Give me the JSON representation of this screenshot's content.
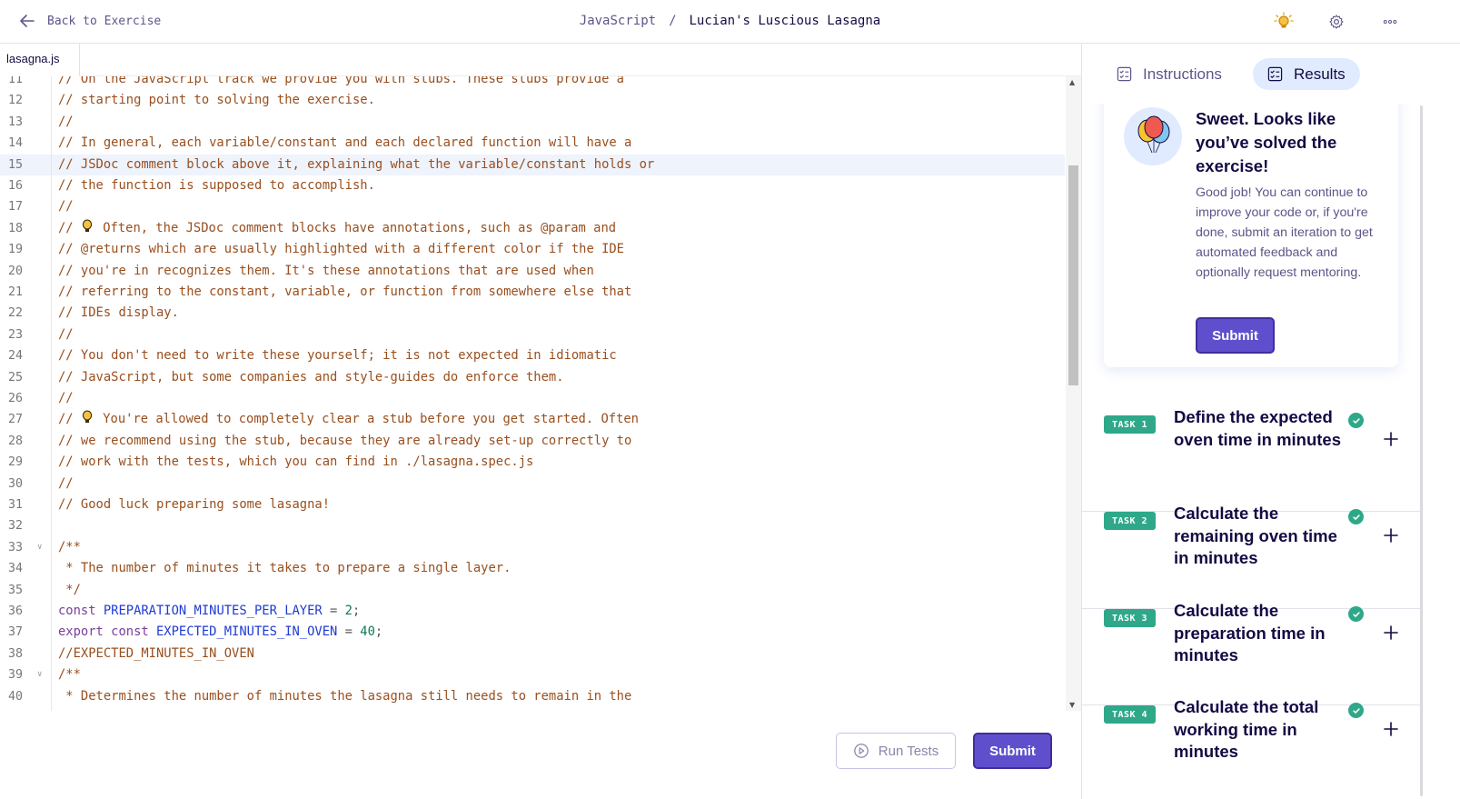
{
  "header": {
    "back_label": "Back to Exercise",
    "track": "JavaScript",
    "separator": "/",
    "exercise": "Lucian's Luscious Lasagna"
  },
  "editor": {
    "filename": "lasagna.js",
    "highlighted_line": 15,
    "lines": [
      {
        "n": "11",
        "t": "// On the JavaScript track we provide you with stubs. These stubs provide a"
      },
      {
        "n": "12",
        "t": "// starting point to solving the exercise."
      },
      {
        "n": "13",
        "t": "//"
      },
      {
        "n": "14",
        "t": "// In general, each variable/constant and each declared function will have a"
      },
      {
        "n": "15",
        "t": "// JSDoc comment block above it, explaining what the variable/constant holds or"
      },
      {
        "n": "16",
        "t": "// the function is supposed to accomplish."
      },
      {
        "n": "17",
        "t": "//"
      },
      {
        "n": "18",
        "pre": "// ",
        "bulb": true,
        "t": "Often, the JSDoc comment blocks have annotations, such as @param and"
      },
      {
        "n": "19",
        "t": "// @returns which are usually highlighted with a different color if the IDE"
      },
      {
        "n": "20",
        "t": "// you're in recognizes them. It's these annotations that are used when"
      },
      {
        "n": "21",
        "t": "// referring to the constant, variable, or function from somewhere else that"
      },
      {
        "n": "22",
        "t": "// IDEs display."
      },
      {
        "n": "23",
        "t": "//"
      },
      {
        "n": "24",
        "t": "// You don't need to write these yourself; it is not expected in idiomatic"
      },
      {
        "n": "25",
        "t": "// JavaScript, but some companies and style-guides do enforce them."
      },
      {
        "n": "26",
        "t": "//"
      },
      {
        "n": "27",
        "pre": "// ",
        "bulb": true,
        "t": "You're allowed to completely clear a stub before you get started. Often"
      },
      {
        "n": "28",
        "t": "// we recommend using the stub, because they are already set-up correctly to"
      },
      {
        "n": "29",
        "t": "// work with the tests, which you can find in ./lasagna.spec.js"
      },
      {
        "n": "30",
        "t": "//"
      },
      {
        "n": "31",
        "t": "// Good luck preparing some lasagna!"
      },
      {
        "n": "32",
        "t": ""
      },
      {
        "n": "33",
        "t": "/**",
        "fold": true
      },
      {
        "n": "34",
        "t": " * The number of minutes it takes to prepare a single layer."
      },
      {
        "n": "35",
        "t": " */"
      },
      {
        "n": "36",
        "kw": "const ",
        "id": "PREPARATION_MINUTES_PER_LAYER",
        "op": " = ",
        "num": "2",
        "end": ";"
      },
      {
        "n": "37",
        "kw": "export const ",
        "id": "EXPECTED_MINUTES_IN_OVEN",
        "op": " = ",
        "num": "40",
        "end": ";"
      },
      {
        "n": "38",
        "t": "//EXPECTED_MINUTES_IN_OVEN"
      },
      {
        "n": "39",
        "t": "/**",
        "fold": true
      },
      {
        "n": "40",
        "t": " * Determines the number of minutes the lasagna still needs to remain in the"
      }
    ],
    "run_tests_label": "Run Tests",
    "submit_label": "Submit"
  },
  "panel": {
    "tab_instructions": "Instructions",
    "tab_results": "Results",
    "active_tab": "Results",
    "success_title": "Sweet. Looks like you’ve solved the exercise!",
    "success_text": "Good job! You can continue to improve your code or, if you're done, submit an iteration to get automated feedback and optionally request mentoring.",
    "submit_label": "Submit",
    "tasks": [
      {
        "badge": "TASK 1",
        "title": "Define the expected oven time in minutes",
        "status": "passed"
      },
      {
        "badge": "TASK 2",
        "title": "Calculate the remaining oven time in minutes",
        "status": "passed"
      },
      {
        "badge": "TASK 3",
        "title": "Calculate the preparation time in minutes",
        "status": "passed"
      },
      {
        "badge": "TASK 4",
        "title": "Calculate the total working time in minutes",
        "status": "passed"
      }
    ]
  },
  "colors": {
    "accent": "#604fcd",
    "success": "#2fa88a",
    "comment": "#994f1e",
    "identifier": "#1f3bd6",
    "keyword": "#7a3e9d"
  },
  "icons": {
    "back": "arrow-left-icon",
    "hint": "lightbulb-icon",
    "settings": "gear-icon",
    "more": "more-dots-icon"
  }
}
